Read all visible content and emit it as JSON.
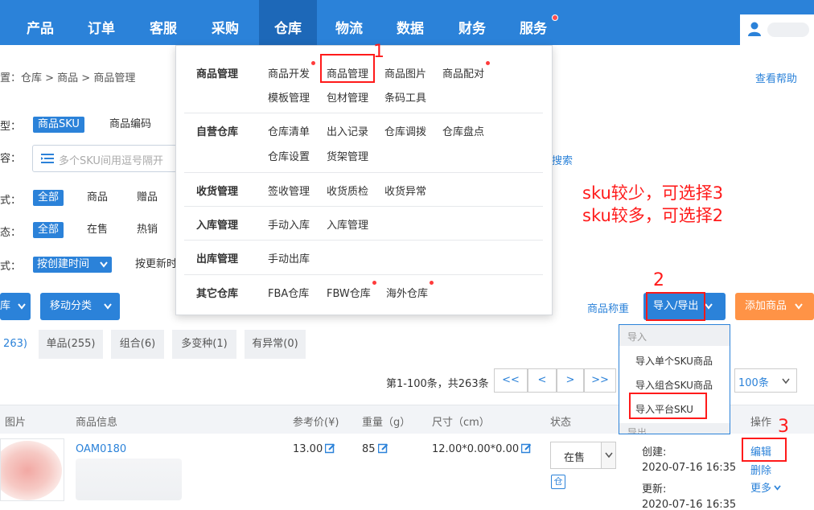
{
  "nav": {
    "items": [
      "产品",
      "订单",
      "客服",
      "采购",
      "仓库",
      "物流",
      "数据",
      "财务",
      "服务"
    ],
    "active": "仓库"
  },
  "breadcrumb": {
    "prefix": "置：",
    "path": "仓库 > 商品 > 商品管理"
  },
  "help_link": "查看帮助",
  "filters": {
    "type_label": "型：",
    "type_options": [
      "商品SKU",
      "商品编码"
    ],
    "content_label": "容：",
    "search_placeholder": "多个SKU间用逗号隔开",
    "search_link": "搜索",
    "style_label": "式：",
    "style_options": [
      "全部",
      "商品",
      "赠品"
    ],
    "status_label": "态：",
    "status_options": [
      "全部",
      "在售",
      "热销"
    ],
    "sort_label": "式：",
    "sort_selected": "按创建时间",
    "sort_other": "按更新时"
  },
  "warehouse_menu": {
    "sections": [
      {
        "name": "商品管理",
        "items": [
          "商品开发",
          "商品管理",
          "商品图片",
          "商品配对",
          "模板管理",
          "包材管理",
          "条码工具"
        ]
      },
      {
        "name": "自营仓库",
        "items": [
          "仓库清单",
          "出入记录",
          "仓库调拨",
          "仓库盘点",
          "仓库设置",
          "货架管理"
        ]
      },
      {
        "name": "收货管理",
        "items": [
          "签收管理",
          "收货质检",
          "收货异常"
        ]
      },
      {
        "name": "入库管理",
        "items": [
          "手动入库",
          "入库管理"
        ]
      },
      {
        "name": "出库管理",
        "items": [
          "手动出库"
        ]
      },
      {
        "name": "其它仓库",
        "items": [
          "FBA仓库",
          "FBW仓库",
          "海外仓库"
        ]
      }
    ]
  },
  "annotations": {
    "note_line1": "sku较少，可选择3",
    "note_line2": "sku较多，可选择2",
    "n1": "1",
    "n2": "2",
    "n3": "3"
  },
  "toolbar": {
    "left_btn": "库",
    "move_btn": "移动分类",
    "weigh_link": "商品称重",
    "import_export": "导入/导出",
    "add_product": "添加商品"
  },
  "io_menu": {
    "group_import": "导入",
    "items": [
      "导入单个SKU商品",
      "导入组合SKU商品",
      "导入平台SKU"
    ],
    "group_export": "导出"
  },
  "tabs": [
    "263)",
    "单品(255)",
    "组合(6)",
    "多变种(1)",
    "有异常(0)"
  ],
  "pagination": {
    "info": "第1-100条，共263条",
    "buttons": [
      "<<",
      "<",
      ">",
      ">>"
    ],
    "page_size": "100条"
  },
  "table": {
    "headers": [
      "图片",
      "商品信息",
      "参考价(¥)",
      "重量（g）",
      "尺寸（cm）",
      "状态",
      "操作"
    ],
    "rows": [
      {
        "sku": "OAM0180",
        "price": "13.00",
        "weight": "85",
        "size": "12.00*0.00*0.00",
        "status": "在售",
        "store_icon": "仓",
        "created_label": "创建:",
        "created": "2020-07-16 16:35",
        "updated_label": "更新:",
        "updated": "2020-07-16 16:35",
        "ops": [
          "编辑",
          "删除",
          "更多"
        ]
      }
    ]
  },
  "colors": {
    "nav_bg": "#2b82d9",
    "nav_active": "#1d68b8",
    "annotation": "#ff1a1a",
    "orange": "#ff9346"
  }
}
